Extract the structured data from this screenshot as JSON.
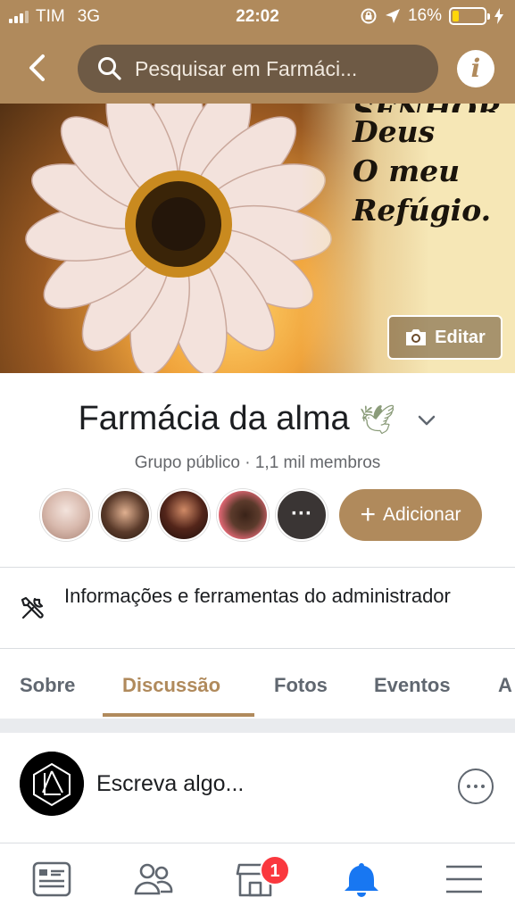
{
  "status_bar": {
    "carrier": "TIM",
    "network": "3G",
    "time": "22:02",
    "battery": "16%",
    "battery_level": 0.16,
    "battery_color": "#ffd60a"
  },
  "header": {
    "search_placeholder": "Pesquisar em Farmáci...",
    "info_label": "i",
    "accent_color": "#b08a5c",
    "icons": [
      "back-arrow-icon",
      "search-icon",
      "info-icon"
    ]
  },
  "cover": {
    "text_lines": [
      "Deus",
      "O meu",
      "Refúgio."
    ],
    "edit_label": "Editar"
  },
  "group": {
    "name": "Farmácia da alma",
    "emoji": "🕊",
    "meta": "Grupo público · 1,1 mil membros",
    "members_more_label": "···",
    "add_label": "Adicionar",
    "add_symbol": "+"
  },
  "admin": {
    "label": "Informações e ferramentas do administrador"
  },
  "tabs": {
    "items": [
      "Sobre",
      "Discussão",
      "Fotos",
      "Eventos",
      "A"
    ],
    "active": "Discussão"
  },
  "composer": {
    "placeholder": "Escreva algo..."
  },
  "bottom_bar": {
    "items": [
      "feed-icon",
      "groups-icon",
      "marketplace-icon",
      "notifications-icon",
      "menu-icon"
    ],
    "marketplace_badge": "1",
    "active_color": "#1877f2"
  }
}
